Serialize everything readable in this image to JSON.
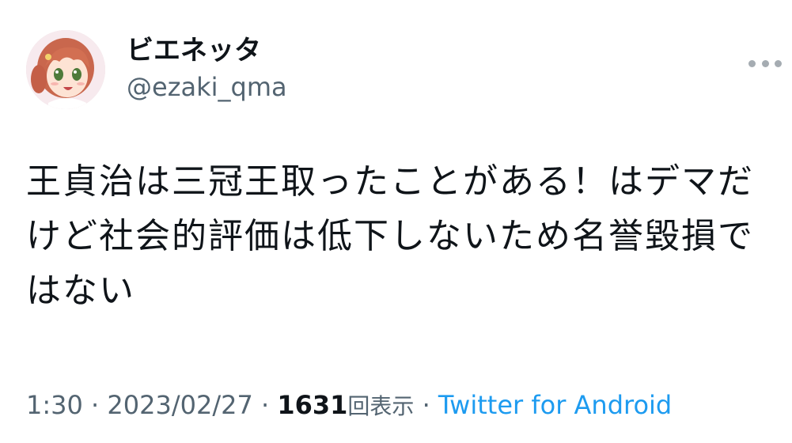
{
  "user": {
    "display_name": "ビエネッタ",
    "handle": "@ezaki_qma"
  },
  "tweet": {
    "text": "王貞治は三冠王取ったことがある！はデマだけど社会的評価は低下しないため名誉毀損ではない"
  },
  "meta": {
    "time": "1:30",
    "sep1": " · ",
    "date": "2023/02/27",
    "sep2": " · ",
    "views_count": "1631",
    "views_label": "回表示",
    "sep3": " · ",
    "source": "Twitter for Android"
  },
  "icons": {
    "more": "more-dots-icon",
    "avatar": "anime-girl-avatar"
  },
  "colors": {
    "text_primary": "#0f1419",
    "text_secondary": "#536471",
    "link": "#1d9bf0"
  }
}
